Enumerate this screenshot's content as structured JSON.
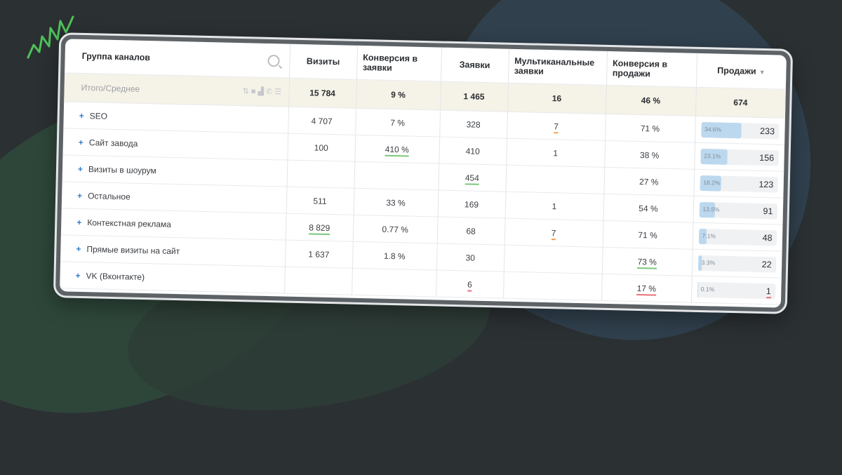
{
  "table": {
    "columns": [
      "Группа каналов",
      "Визиты",
      "Конверсия в заявки",
      "Заявки",
      "Мультиканальные заявки",
      "Конверсия в продажи",
      "Продажи"
    ],
    "total": {
      "label": "Итого/Среднее",
      "visits": "15 784",
      "conv_requests": "9 %",
      "requests": "1 465",
      "multichannel": "16",
      "conv_sales": "46 %",
      "sales": "674"
    },
    "rows": [
      {
        "name": "SEO",
        "visits": "4 707",
        "conv_requests": "7 %",
        "requests": "328",
        "multichannel": "7",
        "conv_sales": "71 %",
        "sales_pct": "34.6%",
        "sales_share": 34.6,
        "sales": "233"
      },
      {
        "name": "Сайт завода",
        "visits": "100",
        "conv_requests": "410 %",
        "requests": "410",
        "multichannel": "1",
        "conv_sales": "38 %",
        "sales_pct": "23.1%",
        "sales_share": 23.1,
        "sales": "156"
      },
      {
        "name": "Визиты в шоурум",
        "visits": "",
        "conv_requests": "",
        "requests": "454",
        "multichannel": "",
        "conv_sales": "27 %",
        "sales_pct": "18.2%",
        "sales_share": 18.2,
        "sales": "123"
      },
      {
        "name": "Остальное",
        "visits": "511",
        "conv_requests": "33 %",
        "requests": "169",
        "multichannel": "1",
        "conv_sales": "54 %",
        "sales_pct": "13.5%",
        "sales_share": 13.5,
        "sales": "91"
      },
      {
        "name": "Контекстная реклама",
        "visits": "8 829",
        "conv_requests": "0.77 %",
        "requests": "68",
        "multichannel": "7",
        "conv_sales": "71 %",
        "sales_pct": "7.1%",
        "sales_share": 7.1,
        "sales": "48"
      },
      {
        "name": "Прямые визиты на сайт",
        "visits": "1 637",
        "conv_requests": "1.8 %",
        "requests": "30",
        "multichannel": "",
        "conv_sales": "73 %",
        "sales_pct": "3.3%",
        "sales_share": 3.3,
        "sales": "22"
      },
      {
        "name": "VK (Вконтакте)",
        "visits": "",
        "conv_requests": "",
        "requests": "6",
        "multichannel": "",
        "conv_sales": "17 %",
        "sales_pct": "0.1%",
        "sales_share": 0.1,
        "sales": "1"
      }
    ]
  },
  "icons": {
    "search": "search-icon",
    "expand": "plus-icon",
    "sort": "sort-desc-icon",
    "toolbar": [
      "sort-icon",
      "table-icon",
      "chart-icon",
      "phone-icon",
      "list-icon"
    ]
  },
  "colors": {
    "bar_fill": "#bcd8ee",
    "expand_plus": "#2e78c7",
    "total_row": "#f5f2e7",
    "accent_green": "#4caf50"
  }
}
